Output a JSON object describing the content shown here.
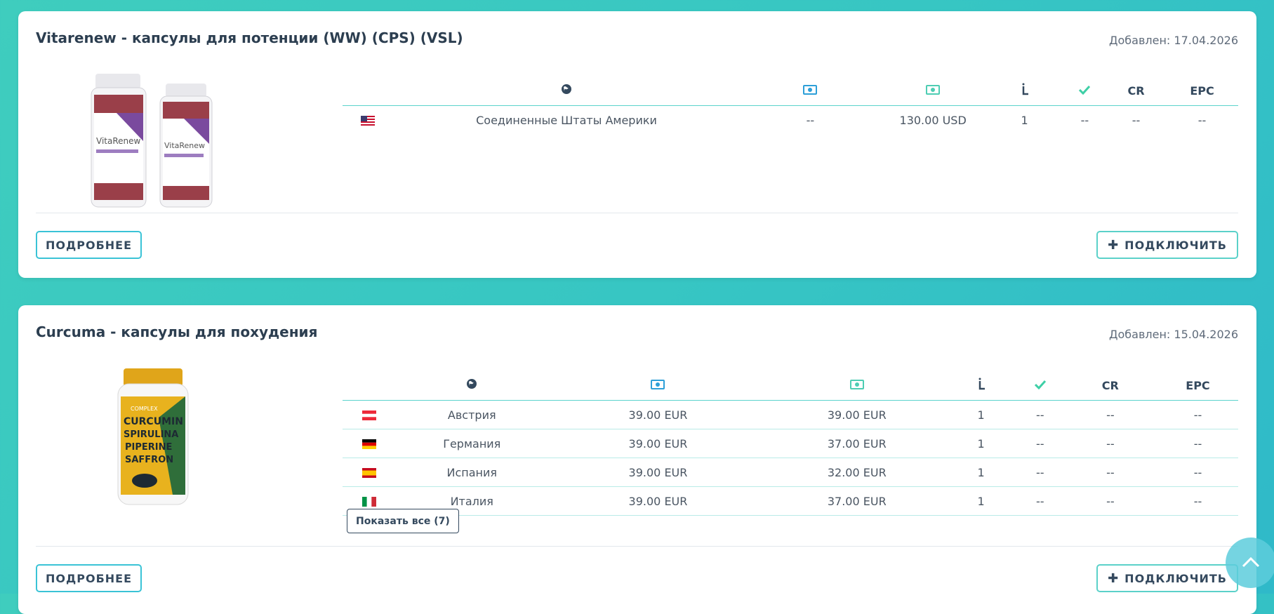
{
  "columns": [
    "",
    "",
    "",
    "",
    "",
    "",
    "CR",
    "EPC"
  ],
  "offers": [
    {
      "title": "Vitarenew - капсулы для потенции (WW) (CPS) (VSL)",
      "added": "Добавлен: 17.04.2026",
      "product_brand": "VitaRenew",
      "rows": [
        {
          "flag": "us",
          "country": "Соединенные Штаты Америки",
          "payout1": "--",
          "payout2": "130.00 USD",
          "lead": "1",
          "approved": "--",
          "cr": "--",
          "epc": "--"
        }
      ],
      "more_label": "ПОДРОБНЕЕ",
      "connect_label": "ПОДКЛЮЧИТЬ"
    },
    {
      "title": "Curcuma - капсулы для похудения",
      "added": "Добавлен: 15.04.2026",
      "product_label_lines": [
        "COMPLEX",
        "CURCUMIN",
        "SPIRULINA",
        "PIPERINE",
        "SAFFRON"
      ],
      "rows": [
        {
          "flag": "at",
          "country": "Австрия",
          "payout1": "39.00 EUR",
          "payout2": "39.00 EUR",
          "lead": "1",
          "approved": "--",
          "cr": "--",
          "epc": "--"
        },
        {
          "flag": "de",
          "country": "Германия",
          "payout1": "39.00 EUR",
          "payout2": "37.00 EUR",
          "lead": "1",
          "approved": "--",
          "cr": "--",
          "epc": "--"
        },
        {
          "flag": "es",
          "country": "Испания",
          "payout1": "39.00 EUR",
          "payout2": "32.00 EUR",
          "lead": "1",
          "approved": "--",
          "cr": "--",
          "epc": "--"
        },
        {
          "flag": "it",
          "country": "Италия",
          "payout1": "39.00 EUR",
          "payout2": "37.00 EUR",
          "lead": "1",
          "approved": "--",
          "cr": "--",
          "epc": "--"
        }
      ],
      "show_all_label": "Показать все (7)",
      "more_label": "ПОДРОБНЕЕ",
      "connect_label": "ПОДКЛЮЧИТЬ"
    }
  ],
  "icons": {
    "country": "globe-icon",
    "payout1": "money-icon",
    "payout2": "money-icon",
    "lead": "lead-icon",
    "approved": "check-icon"
  },
  "colors": {
    "accent": "#3fcdbe",
    "money_blue": "#2d9fd8",
    "money_green": "#4ecdb3",
    "check_green": "#3ecfa6"
  }
}
